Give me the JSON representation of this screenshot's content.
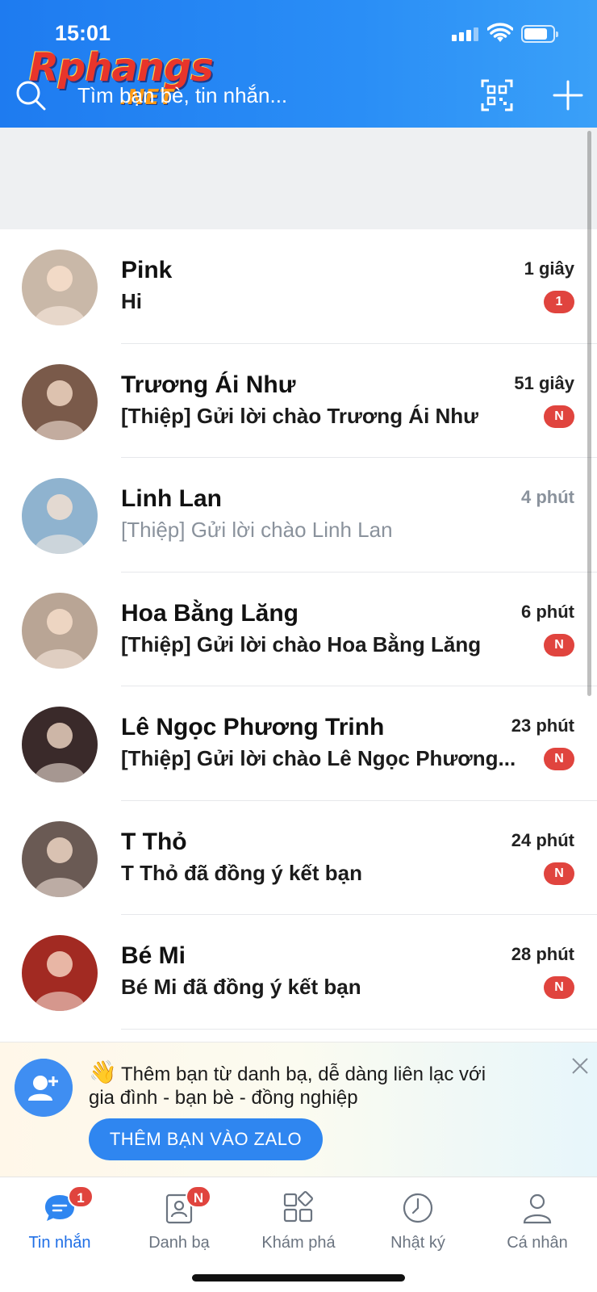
{
  "status_bar": {
    "time": "15:01"
  },
  "watermark": {
    "main": "Rphangs",
    "suffix": ".NET"
  },
  "search": {
    "placeholder": "Tìm bạn bè, tin nhắn..."
  },
  "header_icons": [
    "search-icon",
    "qr-code-icon",
    "plus-icon"
  ],
  "conversations": [
    {
      "name": "Pink",
      "message": "Hi",
      "time": "1 giây",
      "badge": "1",
      "unread": true,
      "avatar_color": "#c9b8a8"
    },
    {
      "name": "Trương Ái Như",
      "message": "[Thiệp] Gửi lời chào Trương Ái Như",
      "time": "51 giây",
      "badge": "N",
      "unread": true,
      "avatar_color": "#7a5a4a"
    },
    {
      "name": "Linh Lan",
      "message": "[Thiệp] Gửi lời chào Linh Lan",
      "time": "4 phút",
      "badge": "",
      "unread": false,
      "avatar_color": "#8fb3cf"
    },
    {
      "name": "Hoa Bằng Lăng",
      "message": "[Thiệp] Gửi lời chào Hoa Bằng Lăng",
      "time": "6 phút",
      "badge": "N",
      "unread": true,
      "avatar_color": "#b9a595"
    },
    {
      "name": "Lê Ngọc Phương Trinh",
      "message": "[Thiệp] Gửi lời chào Lê Ngọc Phương...",
      "time": "23 phút",
      "badge": "N",
      "unread": true,
      "avatar_color": "#3a2a2a"
    },
    {
      "name": "T Thỏ",
      "message": "T Thỏ đã đồng ý kết bạn",
      "time": "24 phút",
      "badge": "N",
      "unread": true,
      "avatar_color": "#6a5a54"
    },
    {
      "name": "Bé Mi",
      "message": "Bé Mi đã đồng ý kết bạn",
      "time": "28 phút",
      "badge": "N",
      "unread": true,
      "avatar_color": "#a22a22"
    }
  ],
  "banner": {
    "emoji": "👋",
    "line1": "Thêm bạn từ danh bạ, dễ dàng liên lạc với",
    "line2": "gia đình - bạn bè - đồng nghiệp",
    "button": "THÊM BẠN VÀO ZALO"
  },
  "tabs": [
    {
      "label": "Tin nhắn",
      "icon": "chat-bubble-icon",
      "badge": "1",
      "active": true
    },
    {
      "label": "Danh bạ",
      "icon": "contacts-icon",
      "badge": "N",
      "active": false
    },
    {
      "label": "Khám phá",
      "icon": "grid-icon",
      "badge": "",
      "active": false
    },
    {
      "label": "Nhật ký",
      "icon": "clock-icon",
      "badge": "",
      "active": false
    },
    {
      "label": "Cá nhân",
      "icon": "person-icon",
      "badge": "",
      "active": false
    }
  ],
  "colors": {
    "header_blue": "#1e7bf0",
    "active_tab": "#1f6fe6",
    "badge_red": "#e0443e"
  }
}
